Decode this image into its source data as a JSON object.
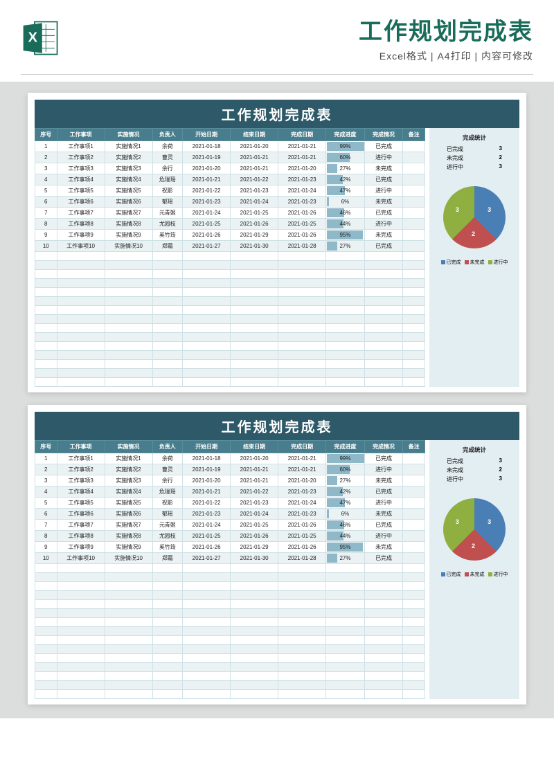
{
  "header": {
    "title": "工作规划完成表",
    "subtitle": "Excel格式 | A4打印 | 内容可修改"
  },
  "sheet_title": "工作规划完成表",
  "columns": [
    "序号",
    "工作事项",
    "实施情况",
    "负责人",
    "开始日期",
    "结束日期",
    "完成日期",
    "完成进度",
    "完成情况",
    "备注"
  ],
  "rows": [
    {
      "n": "1",
      "item": "工作事项1",
      "impl": "实施情况1",
      "owner": "余荷",
      "start": "2021-01-18",
      "end": "2021-01-20",
      "done": "2021-01-21",
      "pct": 99,
      "status": "已完成",
      "note": ""
    },
    {
      "n": "2",
      "item": "工作事项2",
      "impl": "实施情况2",
      "owner": "曹灵",
      "start": "2021-01-19",
      "end": "2021-01-21",
      "done": "2021-01-21",
      "pct": 60,
      "status": "进行中",
      "note": ""
    },
    {
      "n": "3",
      "item": "工作事项3",
      "impl": "实施情况3",
      "owner": "余行",
      "start": "2021-01-20",
      "end": "2021-01-21",
      "done": "2021-01-20",
      "pct": 27,
      "status": "未完成",
      "note": ""
    },
    {
      "n": "4",
      "item": "工作事项4",
      "impl": "实施情况4",
      "owner": "危瑞瑶",
      "start": "2021-01-21",
      "end": "2021-01-22",
      "done": "2021-01-23",
      "pct": 42,
      "status": "已完成",
      "note": ""
    },
    {
      "n": "5",
      "item": "工作事项5",
      "impl": "实施情况5",
      "owner": "祝影",
      "start": "2021-01-22",
      "end": "2021-01-23",
      "done": "2021-01-24",
      "pct": 47,
      "status": "进行中",
      "note": ""
    },
    {
      "n": "6",
      "item": "工作事项6",
      "impl": "实施情况6",
      "owner": "郁瑶",
      "start": "2021-01-23",
      "end": "2021-01-24",
      "done": "2021-01-23",
      "pct": 6,
      "status": "未完成",
      "note": ""
    },
    {
      "n": "7",
      "item": "工作事项7",
      "impl": "实施情况7",
      "owner": "元青姬",
      "start": "2021-01-24",
      "end": "2021-01-25",
      "done": "2021-01-26",
      "pct": 46,
      "status": "已完成",
      "note": ""
    },
    {
      "n": "8",
      "item": "工作事项8",
      "impl": "实施情况8",
      "owner": "尤园枝",
      "start": "2021-01-25",
      "end": "2021-01-26",
      "done": "2021-01-25",
      "pct": 44,
      "status": "进行中",
      "note": ""
    },
    {
      "n": "9",
      "item": "工作事项9",
      "impl": "实施情况9",
      "owner": "奚竹筠",
      "start": "2021-01-26",
      "end": "2021-01-29",
      "done": "2021-01-26",
      "pct": 95,
      "status": "未完成",
      "note": ""
    },
    {
      "n": "10",
      "item": "工作事项10",
      "impl": "实施情况10",
      "owner": "郑霜",
      "start": "2021-01-27",
      "end": "2021-01-30",
      "done": "2021-01-28",
      "pct": 27,
      "status": "已完成",
      "note": ""
    }
  ],
  "empty_row_count": 15,
  "stats": {
    "title": "完成统计",
    "items": [
      {
        "label": "已完成",
        "value": 3
      },
      {
        "label": "未完成",
        "value": 2
      },
      {
        "label": "进行中",
        "value": 3
      }
    ]
  },
  "chart_data": {
    "type": "pie",
    "title": "",
    "series": [
      {
        "name": "已完成",
        "value": 3,
        "color": "#4a7fb5"
      },
      {
        "name": "未完成",
        "value": 2,
        "color": "#c05050"
      },
      {
        "name": "进行中",
        "value": 3,
        "color": "#8fb040"
      }
    ],
    "legend_labels": [
      "已完成",
      "未完成",
      "进行中"
    ]
  },
  "colors": {
    "header_green": "#1a6c5a",
    "band_dark": "#2d5968",
    "band_mid": "#477d8c",
    "row_alt": "#eaf2f4",
    "side_bg": "#e3eef2"
  }
}
